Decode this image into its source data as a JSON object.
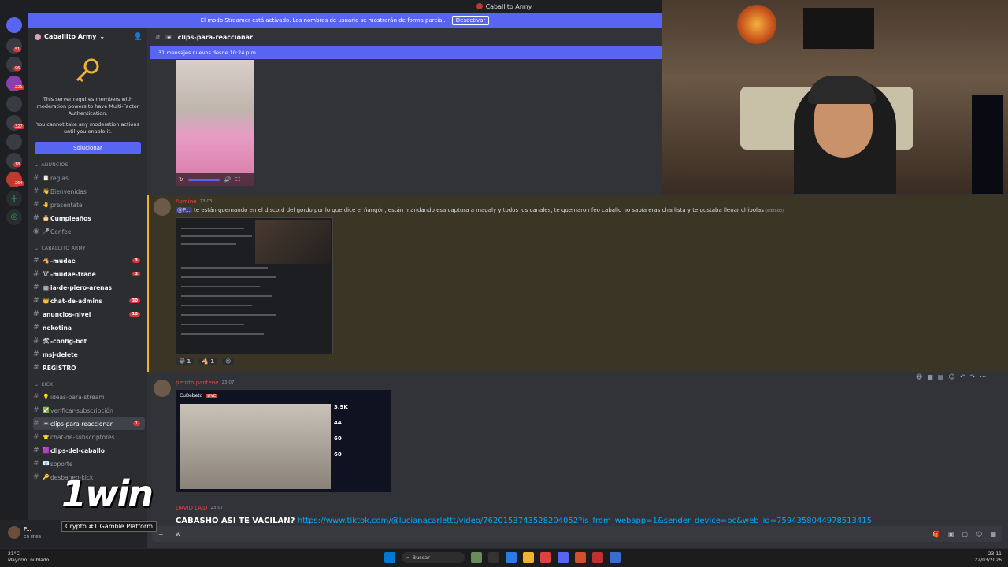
{
  "window": {
    "title": "Caballito Army"
  },
  "banner": {
    "text": "El modo Streamer está activado. Los nombres de usuario se mostrarán de forma parcial.",
    "button": "Desactivar"
  },
  "rail": {
    "badges": [
      "51",
      "96",
      "221",
      "327",
      "264",
      "18"
    ]
  },
  "sidebar": {
    "server_name": "Caballito Army",
    "mfa_text": "This server requires members with moderation powers to have Multi-Factor Authentication.",
    "mfa_text2": "You cannot take any moderation actions until you enable it.",
    "fix_button": "Solucionar",
    "categories": [
      "ANUNCIOS",
      "CABALLITO ARMY",
      "KICK"
    ],
    "channels_a": [
      {
        "name": "reglas",
        "emoji": "📋"
      },
      {
        "name": "Bienvenidas",
        "emoji": "👋"
      },
      {
        "name": "presentate",
        "emoji": "🤚"
      },
      {
        "name": "Cumpleaños",
        "emoji": "🎂"
      },
      {
        "name": "Confee",
        "emoji": "🎤"
      }
    ],
    "channels_b": [
      {
        "name": "-mudae",
        "emoji": "🐴",
        "count": "3"
      },
      {
        "name": "-mudae-trade",
        "emoji": "🐮",
        "count": "3"
      },
      {
        "name": "ia-de-piero-arenas",
        "emoji": "🤖",
        "count": ""
      },
      {
        "name": "chat-de-admins",
        "emoji": "👑",
        "count": "30"
      },
      {
        "name": "anuncios-nivel",
        "emoji": "",
        "count": "10"
      },
      {
        "name": "nekotina",
        "emoji": "",
        "count": ""
      },
      {
        "name": "-config-bot",
        "emoji": "🛠",
        "count": ""
      },
      {
        "name": "msj-delete",
        "emoji": "",
        "count": ""
      },
      {
        "name": "REGISTRO",
        "emoji": "",
        "count": ""
      }
    ],
    "channels_c": [
      {
        "name": "ideas-para-stream",
        "emoji": "💡",
        "count": ""
      },
      {
        "name": "verificar-subscripción",
        "emoji": "✅",
        "count": ""
      },
      {
        "name": "clips-para-reaccionar",
        "emoji": "📼",
        "count": "1"
      },
      {
        "name": "chat-de-subscriptores",
        "emoji": "⭐",
        "count": ""
      },
      {
        "name": "clips-del-caballo",
        "emoji": "🟪",
        "count": ""
      },
      {
        "name": "soporte",
        "emoji": "📧",
        "count": ""
      },
      {
        "name": "desbaneo-kick",
        "emoji": "🔑",
        "count": ""
      }
    ]
  },
  "user": {
    "name": "P...",
    "status": "En línea"
  },
  "overlay": {
    "brand": "1win",
    "tagline": "Crypto #1 Gamble Platform"
  },
  "chat": {
    "channel": "clips-para-reaccionar",
    "new_messages": "31 mensajes nuevos desde 10:24 p.m.",
    "msg1": {
      "author": "Aomine",
      "time": "23:03",
      "mention": "@P...",
      "text": "te están quemando en el discord del gordo por lo que dice el ñangón, están mandando esa captura a magaly y todos los canales, te quemaron feo caballo no sabía eras charlista y te gustaba llenar chibolas",
      "edited": "(editado)",
      "reactions": [
        "1",
        "1"
      ]
    },
    "msg2": {
      "author": "perrito pantene",
      "time": "23:07",
      "stream_name": "CuBebeto",
      "stream_live": "LIVE",
      "stats": [
        "3.9K",
        "44",
        "60",
        "60"
      ]
    },
    "msg3": {
      "author": "DAVID LAID",
      "time": "23:07",
      "text": "CABASHO ASI TE VACILAN? ",
      "url": "https://www.tiktok.com/@lucianacarlettt/video/7620153743528204052?is_from_webapp=1&sender_device=pc&web_id=7594358044978513415"
    },
    "composer_value": "w"
  },
  "taskbar": {
    "weather_temp": "21°C",
    "weather_desc": "Mayorm. nublado",
    "search": "Buscar",
    "time": "23:11",
    "date": "22/03/2026"
  }
}
